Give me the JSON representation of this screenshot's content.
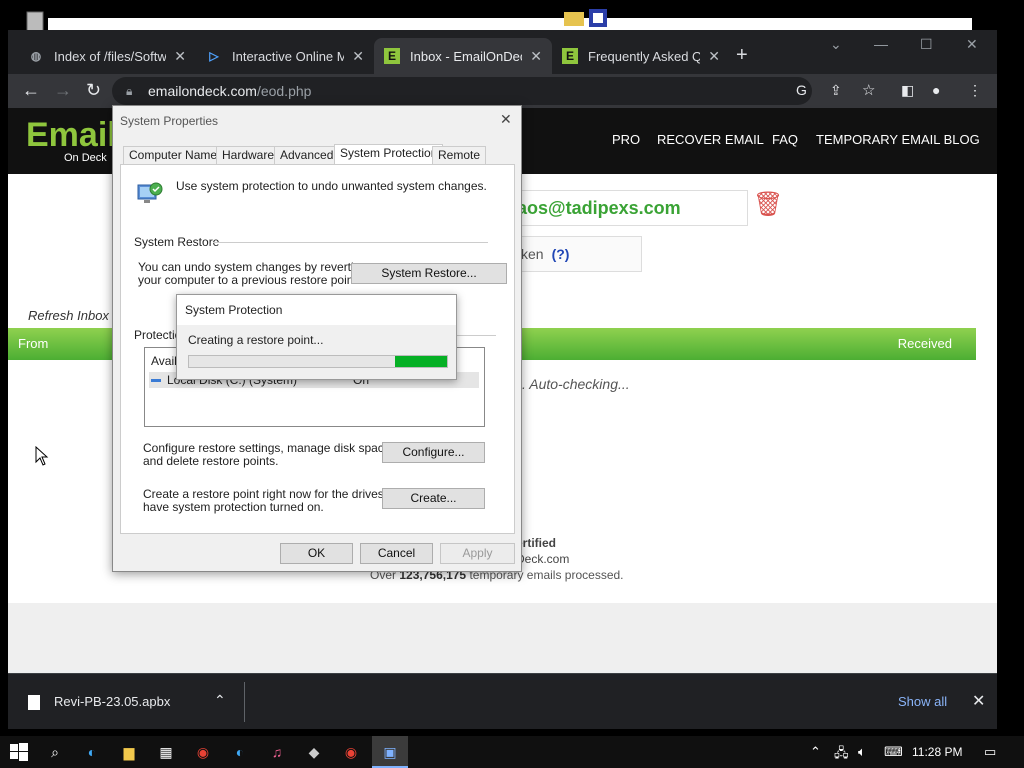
{
  "browser": {
    "tabs": [
      {
        "title": "Index of /files/Softwa",
        "favicon": "globe-icon"
      },
      {
        "title": "Interactive Online Ma",
        "favicon": "edge-chevron-icon"
      },
      {
        "title": "Inbox - EmailOnDeck",
        "favicon": "letter-e-icon"
      },
      {
        "title": "Frequently Asked Qu",
        "favicon": "letter-e-icon"
      }
    ],
    "address_host": "emailondeck.com",
    "address_path": "/eod.php"
  },
  "site": {
    "logo": "Email",
    "logo_sub": "On Deck",
    "nav": [
      "PRO",
      "RECOVER EMAIL",
      "FAQ",
      "TEMPORARY EMAIL BLOG"
    ],
    "email_visible": "aos@tadipexs.com",
    "token_visible": "ken",
    "token_help": "(?)",
    "refresh": "Refresh Inbox",
    "col_from": "From",
    "col_received": "Received",
    "autocheck": ". Auto-checking...",
    "cert_line1": "ertified",
    "cert_line2": "Deck.com",
    "processed_pre": "Over",
    "processed_count": "123,756,175",
    "processed_post": "temporary emails processed."
  },
  "downloads": {
    "file": "Revi-PB-23.05.apbx",
    "show_all": "Show all"
  },
  "dialog": {
    "title": "System Properties",
    "tabs": [
      "Computer Name",
      "Hardware",
      "Advanced",
      "System Protection",
      "Remote"
    ],
    "intro": "Use system protection to undo unwanted system changes.",
    "system_restore_label": "System Restore",
    "restore_text_1": "You can undo system changes by reverting",
    "restore_text_2": "your computer to a previous restore point.",
    "restore_button": "System Restore...",
    "protection_label": "Protection",
    "list_header": "Availa",
    "drive_name": "Local Disk (C:) (System)",
    "drive_status": "On",
    "configure_text_1": "Configure restore settings, manage disk space,",
    "configure_text_2": "and delete restore points.",
    "configure_button": "Configure...",
    "create_text_1": "Create a restore point right now for the drives that",
    "create_text_2": "have system protection turned on.",
    "create_button": "Create...",
    "ok": "OK",
    "cancel": "Cancel",
    "apply": "Apply"
  },
  "progress_popup": {
    "title": "System Protection",
    "message": "Creating a restore point...",
    "fill_start": 0.8,
    "fill_end": 1.0,
    "color": "#06b025"
  },
  "taskbar": {
    "time": "11:28 PM"
  }
}
